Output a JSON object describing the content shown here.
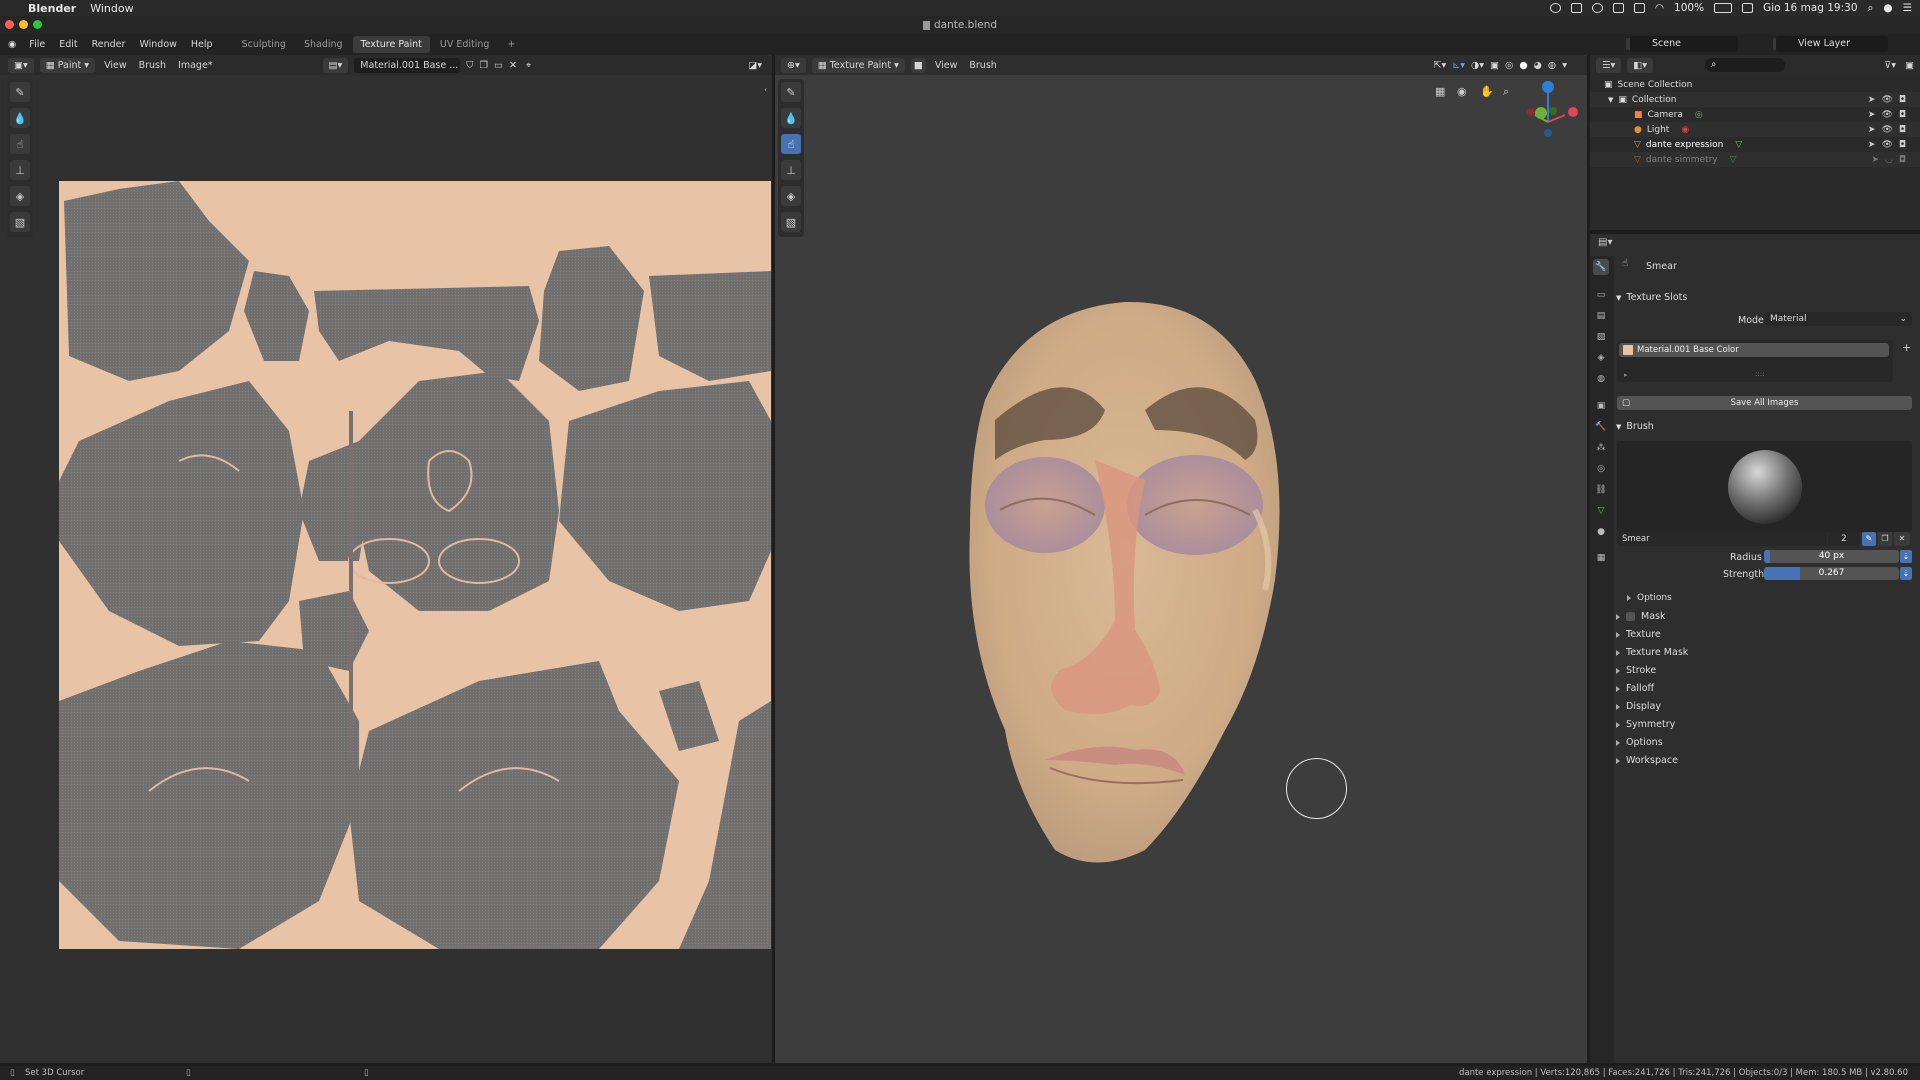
{
  "mac": {
    "app_name": "Blender",
    "menu_window": "Window",
    "battery": "100%",
    "datetime": "Gio 16 mag 19:30"
  },
  "window_title": "dante.blend",
  "topbar": {
    "menus": [
      "File",
      "Edit",
      "Render",
      "Window",
      "Help"
    ],
    "tabs": [
      "Sculpting",
      "Shading",
      "Texture Paint",
      "UV Editing"
    ],
    "active_tab": "Texture Paint",
    "add_tab": "+",
    "scene": "Scene",
    "view_layer": "View Layer"
  },
  "image_editor": {
    "mode": "Paint",
    "menus": [
      "View",
      "Brush",
      "Image*"
    ],
    "image_name": "Material.001 Base ..."
  },
  "viewport": {
    "mode": "Texture Paint",
    "menus": [
      "View",
      "Brush"
    ]
  },
  "outliner": {
    "root": "Scene Collection",
    "collection": "Collection",
    "items": [
      "Camera",
      "Light",
      "dante expression",
      "dante simmetry"
    ]
  },
  "properties": {
    "tool_name": "Smear",
    "texture_slots_header": "Texture Slots",
    "mode_label": "Mode",
    "mode_value": "Material",
    "slot_name": "Material.001 Base Color",
    "save_all": "Save All Images",
    "brush_header": "Brush",
    "brush_name": "Smear",
    "brush_users": "2",
    "radius_label": "Radius",
    "radius_value": "40 px",
    "strength_label": "Strength",
    "strength_value": "0.267",
    "strength_fraction": 0.267,
    "options_sub": "Options",
    "sections": [
      "Mask",
      "Texture",
      "Texture Mask",
      "Stroke",
      "Falloff",
      "Display",
      "Symmetry",
      "Options",
      "Workspace"
    ]
  },
  "status": {
    "left": "Set 3D Cursor",
    "right": "dante expression | Verts:120,865 | Faces:241,726 | Tris:241,726 | Objects:0/3 | Mem: 180.5 MB | v2.80.60"
  },
  "colors": {
    "accent": "#4772b3",
    "skin": "#e9c3a5",
    "uv_gray": "#6e6e6e",
    "panel": "#303030"
  }
}
